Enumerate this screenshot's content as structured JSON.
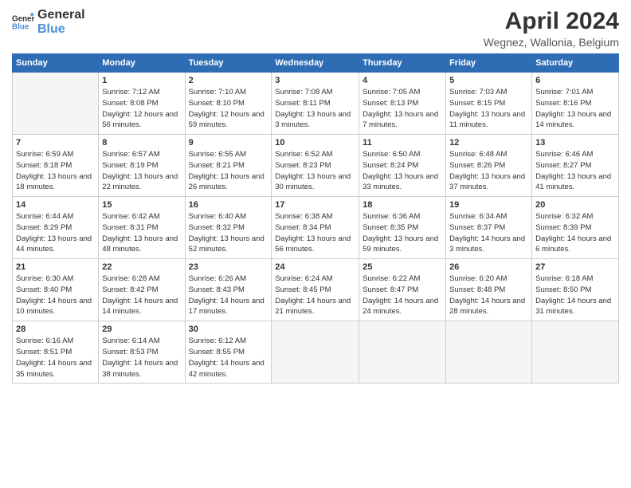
{
  "logo": {
    "line1": "General",
    "line2": "Blue"
  },
  "title": "April 2024",
  "subtitle": "Wegnez, Wallonia, Belgium",
  "days_header": [
    "Sunday",
    "Monday",
    "Tuesday",
    "Wednesday",
    "Thursday",
    "Friday",
    "Saturday"
  ],
  "weeks": [
    [
      {
        "num": "",
        "sunrise": "",
        "sunset": "",
        "daylight": ""
      },
      {
        "num": "1",
        "sunrise": "Sunrise: 7:12 AM",
        "sunset": "Sunset: 8:08 PM",
        "daylight": "Daylight: 12 hours and 56 minutes."
      },
      {
        "num": "2",
        "sunrise": "Sunrise: 7:10 AM",
        "sunset": "Sunset: 8:10 PM",
        "daylight": "Daylight: 12 hours and 59 minutes."
      },
      {
        "num": "3",
        "sunrise": "Sunrise: 7:08 AM",
        "sunset": "Sunset: 8:11 PM",
        "daylight": "Daylight: 13 hours and 3 minutes."
      },
      {
        "num": "4",
        "sunrise": "Sunrise: 7:05 AM",
        "sunset": "Sunset: 8:13 PM",
        "daylight": "Daylight: 13 hours and 7 minutes."
      },
      {
        "num": "5",
        "sunrise": "Sunrise: 7:03 AM",
        "sunset": "Sunset: 8:15 PM",
        "daylight": "Daylight: 13 hours and 11 minutes."
      },
      {
        "num": "6",
        "sunrise": "Sunrise: 7:01 AM",
        "sunset": "Sunset: 8:16 PM",
        "daylight": "Daylight: 13 hours and 14 minutes."
      }
    ],
    [
      {
        "num": "7",
        "sunrise": "Sunrise: 6:59 AM",
        "sunset": "Sunset: 8:18 PM",
        "daylight": "Daylight: 13 hours and 18 minutes."
      },
      {
        "num": "8",
        "sunrise": "Sunrise: 6:57 AM",
        "sunset": "Sunset: 8:19 PM",
        "daylight": "Daylight: 13 hours and 22 minutes."
      },
      {
        "num": "9",
        "sunrise": "Sunrise: 6:55 AM",
        "sunset": "Sunset: 8:21 PM",
        "daylight": "Daylight: 13 hours and 26 minutes."
      },
      {
        "num": "10",
        "sunrise": "Sunrise: 6:52 AM",
        "sunset": "Sunset: 8:23 PM",
        "daylight": "Daylight: 13 hours and 30 minutes."
      },
      {
        "num": "11",
        "sunrise": "Sunrise: 6:50 AM",
        "sunset": "Sunset: 8:24 PM",
        "daylight": "Daylight: 13 hours and 33 minutes."
      },
      {
        "num": "12",
        "sunrise": "Sunrise: 6:48 AM",
        "sunset": "Sunset: 8:26 PM",
        "daylight": "Daylight: 13 hours and 37 minutes."
      },
      {
        "num": "13",
        "sunrise": "Sunrise: 6:46 AM",
        "sunset": "Sunset: 8:27 PM",
        "daylight": "Daylight: 13 hours and 41 minutes."
      }
    ],
    [
      {
        "num": "14",
        "sunrise": "Sunrise: 6:44 AM",
        "sunset": "Sunset: 8:29 PM",
        "daylight": "Daylight: 13 hours and 44 minutes."
      },
      {
        "num": "15",
        "sunrise": "Sunrise: 6:42 AM",
        "sunset": "Sunset: 8:31 PM",
        "daylight": "Daylight: 13 hours and 48 minutes."
      },
      {
        "num": "16",
        "sunrise": "Sunrise: 6:40 AM",
        "sunset": "Sunset: 8:32 PM",
        "daylight": "Daylight: 13 hours and 52 minutes."
      },
      {
        "num": "17",
        "sunrise": "Sunrise: 6:38 AM",
        "sunset": "Sunset: 8:34 PM",
        "daylight": "Daylight: 13 hours and 56 minutes."
      },
      {
        "num": "18",
        "sunrise": "Sunrise: 6:36 AM",
        "sunset": "Sunset: 8:35 PM",
        "daylight": "Daylight: 13 hours and 59 minutes."
      },
      {
        "num": "19",
        "sunrise": "Sunrise: 6:34 AM",
        "sunset": "Sunset: 8:37 PM",
        "daylight": "Daylight: 14 hours and 3 minutes."
      },
      {
        "num": "20",
        "sunrise": "Sunrise: 6:32 AM",
        "sunset": "Sunset: 8:39 PM",
        "daylight": "Daylight: 14 hours and 6 minutes."
      }
    ],
    [
      {
        "num": "21",
        "sunrise": "Sunrise: 6:30 AM",
        "sunset": "Sunset: 8:40 PM",
        "daylight": "Daylight: 14 hours and 10 minutes."
      },
      {
        "num": "22",
        "sunrise": "Sunrise: 6:28 AM",
        "sunset": "Sunset: 8:42 PM",
        "daylight": "Daylight: 14 hours and 14 minutes."
      },
      {
        "num": "23",
        "sunrise": "Sunrise: 6:26 AM",
        "sunset": "Sunset: 8:43 PM",
        "daylight": "Daylight: 14 hours and 17 minutes."
      },
      {
        "num": "24",
        "sunrise": "Sunrise: 6:24 AM",
        "sunset": "Sunset: 8:45 PM",
        "daylight": "Daylight: 14 hours and 21 minutes."
      },
      {
        "num": "25",
        "sunrise": "Sunrise: 6:22 AM",
        "sunset": "Sunset: 8:47 PM",
        "daylight": "Daylight: 14 hours and 24 minutes."
      },
      {
        "num": "26",
        "sunrise": "Sunrise: 6:20 AM",
        "sunset": "Sunset: 8:48 PM",
        "daylight": "Daylight: 14 hours and 28 minutes."
      },
      {
        "num": "27",
        "sunrise": "Sunrise: 6:18 AM",
        "sunset": "Sunset: 8:50 PM",
        "daylight": "Daylight: 14 hours and 31 minutes."
      }
    ],
    [
      {
        "num": "28",
        "sunrise": "Sunrise: 6:16 AM",
        "sunset": "Sunset: 8:51 PM",
        "daylight": "Daylight: 14 hours and 35 minutes."
      },
      {
        "num": "29",
        "sunrise": "Sunrise: 6:14 AM",
        "sunset": "Sunset: 8:53 PM",
        "daylight": "Daylight: 14 hours and 38 minutes."
      },
      {
        "num": "30",
        "sunrise": "Sunrise: 6:12 AM",
        "sunset": "Sunset: 8:55 PM",
        "daylight": "Daylight: 14 hours and 42 minutes."
      },
      {
        "num": "",
        "sunrise": "",
        "sunset": "",
        "daylight": ""
      },
      {
        "num": "",
        "sunrise": "",
        "sunset": "",
        "daylight": ""
      },
      {
        "num": "",
        "sunrise": "",
        "sunset": "",
        "daylight": ""
      },
      {
        "num": "",
        "sunrise": "",
        "sunset": "",
        "daylight": ""
      }
    ]
  ]
}
